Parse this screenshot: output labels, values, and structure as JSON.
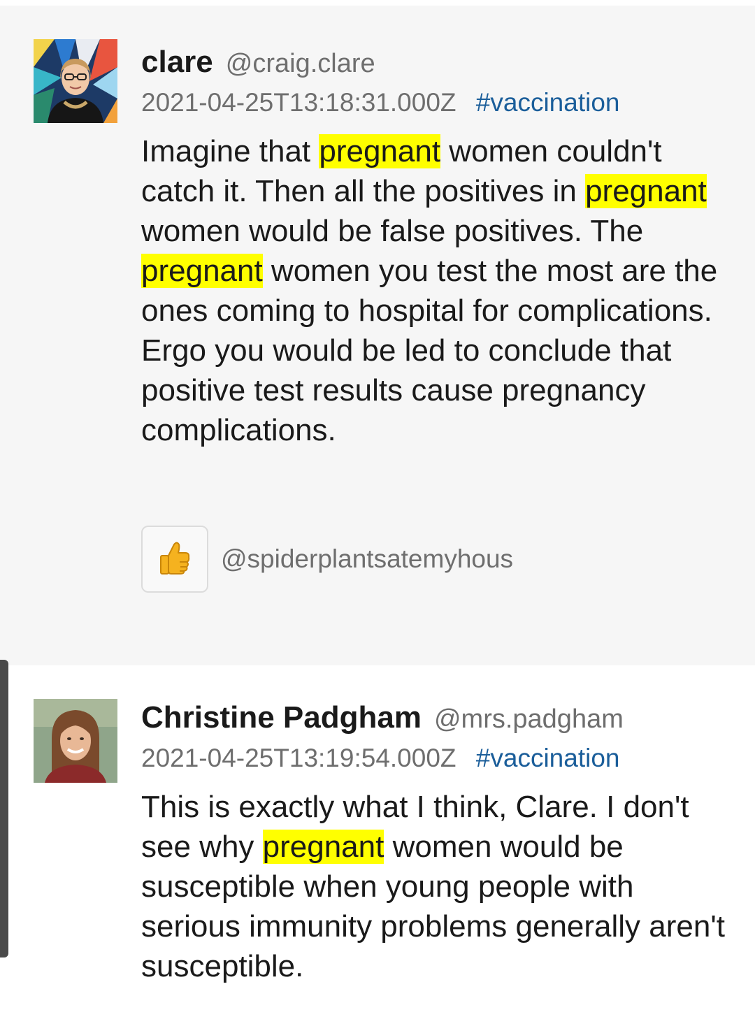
{
  "posts": [
    {
      "author": "clare",
      "handle": "@craig.clare",
      "timestamp": "2021-04-25T13:18:31.000Z",
      "hashtag": "#vaccination",
      "body_segments": [
        {
          "text": "Imagine that ",
          "highlight": false
        },
        {
          "text": "pregnant",
          "highlight": true
        },
        {
          "text": " women couldn't catch it. Then all the positives in ",
          "highlight": false
        },
        {
          "text": "pregnant",
          "highlight": true
        },
        {
          "text": " women would be false positives. The ",
          "highlight": false
        },
        {
          "text": "pregnant",
          "highlight": true
        },
        {
          "text": " women you test the most are the ones coming to hospital for complications. Ergo you would be led to conclude that positive test results cause pregnancy complications.",
          "highlight": false
        }
      ],
      "reaction": {
        "icon": "thumbs-up-icon",
        "user": "@spiderplantsatemyhous"
      }
    },
    {
      "author": "Christine Padgham",
      "handle": "@mrs.padgham",
      "timestamp": "2021-04-25T13:19:54.000Z",
      "hashtag": "#vaccination",
      "body_segments": [
        {
          "text": "This is exactly what I think, Clare. I don't see why ",
          "highlight": false
        },
        {
          "text": "pregnant",
          "highlight": true
        },
        {
          "text": " women would be susceptible when young people with serious immunity problems generally aren't susceptible.",
          "highlight": false
        }
      ]
    }
  ],
  "colors": {
    "highlight": "#ffff00",
    "hashtag": "#1b5e9a",
    "muted": "#6e6e6e",
    "post_bg_selected": "#f6f6f6"
  }
}
